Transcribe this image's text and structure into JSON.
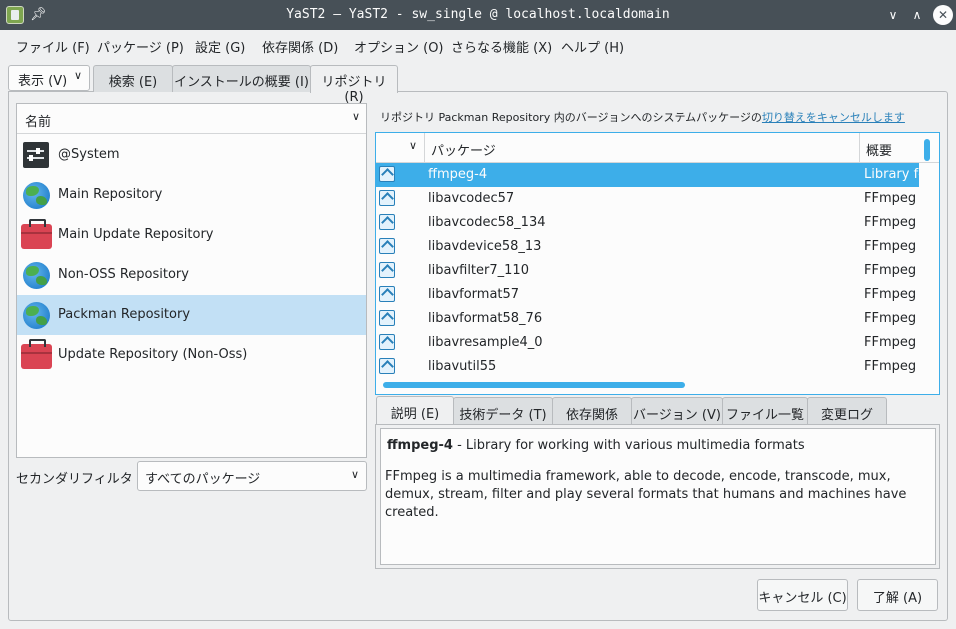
{
  "window": {
    "title": "YaST2 — YaST2 - sw_single @ localhost.localdomain"
  },
  "menu": [
    "ファイル (F)",
    "パッケージ (P)",
    "設定 (G)",
    "依存関係 (D)",
    "オプション (O)",
    "さらなる機能 (X)",
    "ヘルプ (H)"
  ],
  "view_combo": "表示 (V)",
  "top_tabs": [
    "検索 (E)",
    "インストールの概要 (I)",
    "リポジトリ (R)"
  ],
  "repo_list": {
    "header": "名前",
    "items": [
      {
        "label": "@System",
        "icon": "system-icon"
      },
      {
        "label": "Main Repository",
        "icon": "globe-icon"
      },
      {
        "label": "Main Update Repository",
        "icon": "toolbox-icon"
      },
      {
        "label": "Non-OSS Repository",
        "icon": "globe-icon"
      },
      {
        "label": "Packman Repository",
        "icon": "globe-icon",
        "selected": true
      },
      {
        "label": "Update Repository (Non-Oss)",
        "icon": "toolbox-icon"
      }
    ]
  },
  "secondary_filter": {
    "label": "セカンダリフィルタ (S):",
    "value": "すべてのパッケージ"
  },
  "info_line": {
    "text": "リポジトリ Packman Repository 内のバージョンへのシステムパッケージの",
    "link": "切り替えをキャンセルします"
  },
  "package_table": {
    "columns": [
      "パッケージ",
      "概要"
    ],
    "rows": [
      {
        "name": "ffmpeg-4",
        "summary": "Library for",
        "selected": true
      },
      {
        "name": "libavcodec57",
        "summary": "FFmpeg c"
      },
      {
        "name": "libavcodec58_134",
        "summary": "FFmpeg c"
      },
      {
        "name": "libavdevice58_13",
        "summary": "FFmpeg d"
      },
      {
        "name": "libavfilter7_110",
        "summary": "FFmpeg a"
      },
      {
        "name": "libavformat57",
        "summary": "FFmpeg c"
      },
      {
        "name": "libavformat58_76",
        "summary": "FFmpeg c"
      },
      {
        "name": "libavresample4_0",
        "summary": "FFmpeg a"
      },
      {
        "name": "libavutil55",
        "summary": "FFmpeg u"
      }
    ]
  },
  "detail_tabs": [
    "説明 (E)",
    "技術データ (T)",
    "依存関係",
    "バージョン (V)",
    "ファイル一覧",
    "変更ログ"
  ],
  "detail": {
    "package_name": "ffmpeg-4",
    "summary": " - Library for working with various multimedia formats",
    "description": "FFmpeg is a multimedia framework, able to decode, encode, transcode, mux, demux, stream, filter and play several formats that humans and machines have created."
  },
  "buttons": {
    "cancel": "キャンセル (C)",
    "ok": "了解 (A)"
  },
  "colors": {
    "titlebar": "#475057",
    "accent": "#3daee9",
    "selection_light": "#c2e0f5"
  }
}
